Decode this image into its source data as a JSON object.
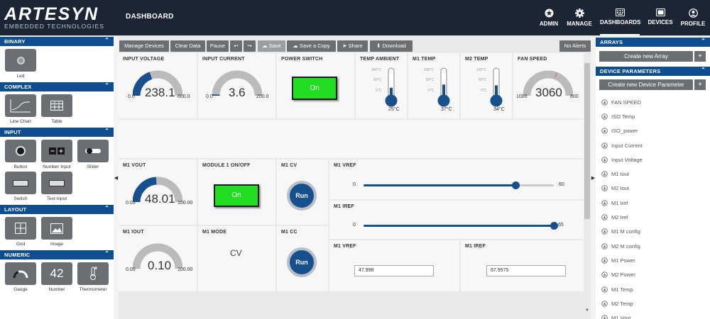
{
  "app": {
    "brand": "ARTESYN",
    "brand_sub": "EMBEDDED TECHNOLOGIES",
    "page_title": "DASHBOARD"
  },
  "nav": [
    {
      "label": "ADMIN",
      "icon": "gear-badge-icon"
    },
    {
      "label": "MANAGE",
      "icon": "gear-icon"
    },
    {
      "label": "DASHBOARDS",
      "icon": "keyboard-icon"
    },
    {
      "label": "DEVICES",
      "icon": "monitor-icon"
    },
    {
      "label": "PROFILE",
      "icon": "user-icon"
    }
  ],
  "palette": {
    "sections": [
      {
        "title": "BINARY",
        "items": [
          {
            "label": "Led",
            "icon": "led-icon"
          }
        ]
      },
      {
        "title": "COMPLEX",
        "items": [
          {
            "label": "Line Chart",
            "icon": "line-chart-icon"
          },
          {
            "label": "Table",
            "icon": "table-icon"
          }
        ]
      },
      {
        "title": "INPUT",
        "items": [
          {
            "label": "Button",
            "icon": "button-icon"
          },
          {
            "label": "Number Input",
            "icon": "number-input-icon"
          },
          {
            "label": "Slider",
            "icon": "slider-icon"
          },
          {
            "label": "Switch",
            "icon": "switch-icon"
          },
          {
            "label": "Text Input",
            "icon": "text-input-icon"
          }
        ]
      },
      {
        "title": "LAYOUT",
        "items": [
          {
            "label": "Grid",
            "icon": "grid-icon"
          },
          {
            "label": "Image",
            "icon": "image-icon"
          }
        ]
      },
      {
        "title": "NUMERIC",
        "items": [
          {
            "label": "Gauge",
            "icon": "gauge-icon"
          },
          {
            "label": "Number",
            "icon": "number-icon",
            "glyph": "42"
          },
          {
            "label": "Thermometer",
            "icon": "thermometer-icon"
          }
        ]
      }
    ]
  },
  "toolbar": {
    "manage_devices": "Manage Devices",
    "clear_data": "Clear Data",
    "pause": "Pause",
    "undo_icon": "undo-icon",
    "redo_icon": "redo-icon",
    "save": "Save",
    "save_as_copy": "Save a Copy",
    "share": "Share",
    "download": "Download",
    "no_alerts": "No Alerts"
  },
  "widgets": {
    "input_voltage": {
      "title": "INPUT VOLTAGE",
      "min": "0.0",
      "max": "600.0",
      "value": "238.1",
      "fraction": 0.397
    },
    "input_current": {
      "title": "INPUT CURRENT",
      "min": "0.0",
      "max": "200.0",
      "value": "3.6",
      "fraction": 0.018
    },
    "power_switch": {
      "title": "POWER SWITCH",
      "label": "On"
    },
    "temp_ambient": {
      "title": "TEMP AMBIENT",
      "scale": [
        "100°C",
        "50°C",
        "0°C"
      ],
      "value": "25°C",
      "fraction": 0.25
    },
    "m1_temp": {
      "title": "M1 TEMP",
      "scale": [
        "100°C",
        "50°C",
        "0°C"
      ],
      "value": "37°C",
      "fraction": 0.37
    },
    "m2_temp": {
      "title": "M2 TEMP",
      "scale": [
        "100°C",
        "50°C",
        "0°C"
      ],
      "value": "34°C",
      "fraction": 0.34
    },
    "fan_speed": {
      "title": "FAN SPEED",
      "min": "1000",
      "max": "800",
      "value": "3060",
      "fraction": 0.0
    },
    "m1_vout": {
      "title": "M1 VOUT",
      "min": "0.00",
      "max": "100.00",
      "value": "48.01",
      "fraction": 0.48
    },
    "module1": {
      "title": "MODULE 1 ON/OFF",
      "label": "On"
    },
    "m1_cv": {
      "title": "M1 CV",
      "label": "Run"
    },
    "m1_vref_slider": {
      "title": "M1 VREF",
      "min": "0",
      "max": "60",
      "fraction": 0.8
    },
    "m1_iref_slider": {
      "title": "M1 IREF",
      "min": "0",
      "max": "65",
      "fraction": 1.0
    },
    "m1_iout": {
      "title": "M1 IOUT",
      "min": "0.00",
      "max": "100.00",
      "value": "0.10",
      "fraction": 0.001
    },
    "m1_mode": {
      "title": "M1 MODE",
      "value": "CV"
    },
    "m1_cc": {
      "title": "M1 CC",
      "label": "Run"
    },
    "m1_vref_input": {
      "title": "M1 VREF",
      "value": "47.998"
    },
    "m1_iref_input": {
      "title": "M1 IREF",
      "value": "67.9575"
    }
  },
  "right": {
    "arrays_title": "ARRAYS",
    "create_array": "Create new Array",
    "params_title": "DEVICE PARAMETERS",
    "create_param": "Create new Device Parameter",
    "params": [
      "FAN SPEED",
      "ISO Temp",
      "ISO_power",
      "Input Current",
      "Input Voltage",
      "M1 Iout",
      "M2 Iout",
      "M1 Iref",
      "M2 Iref",
      "M1 M config",
      "M2 M config",
      "M1 Power",
      "M2 Power",
      "M1 Temp",
      "M2 Temp",
      "M1 Vout"
    ]
  },
  "colors": {
    "accent": "#17508d",
    "header": "#1c2533",
    "switch_on": "#22dd22",
    "panel_header": "#0f4d91"
  }
}
